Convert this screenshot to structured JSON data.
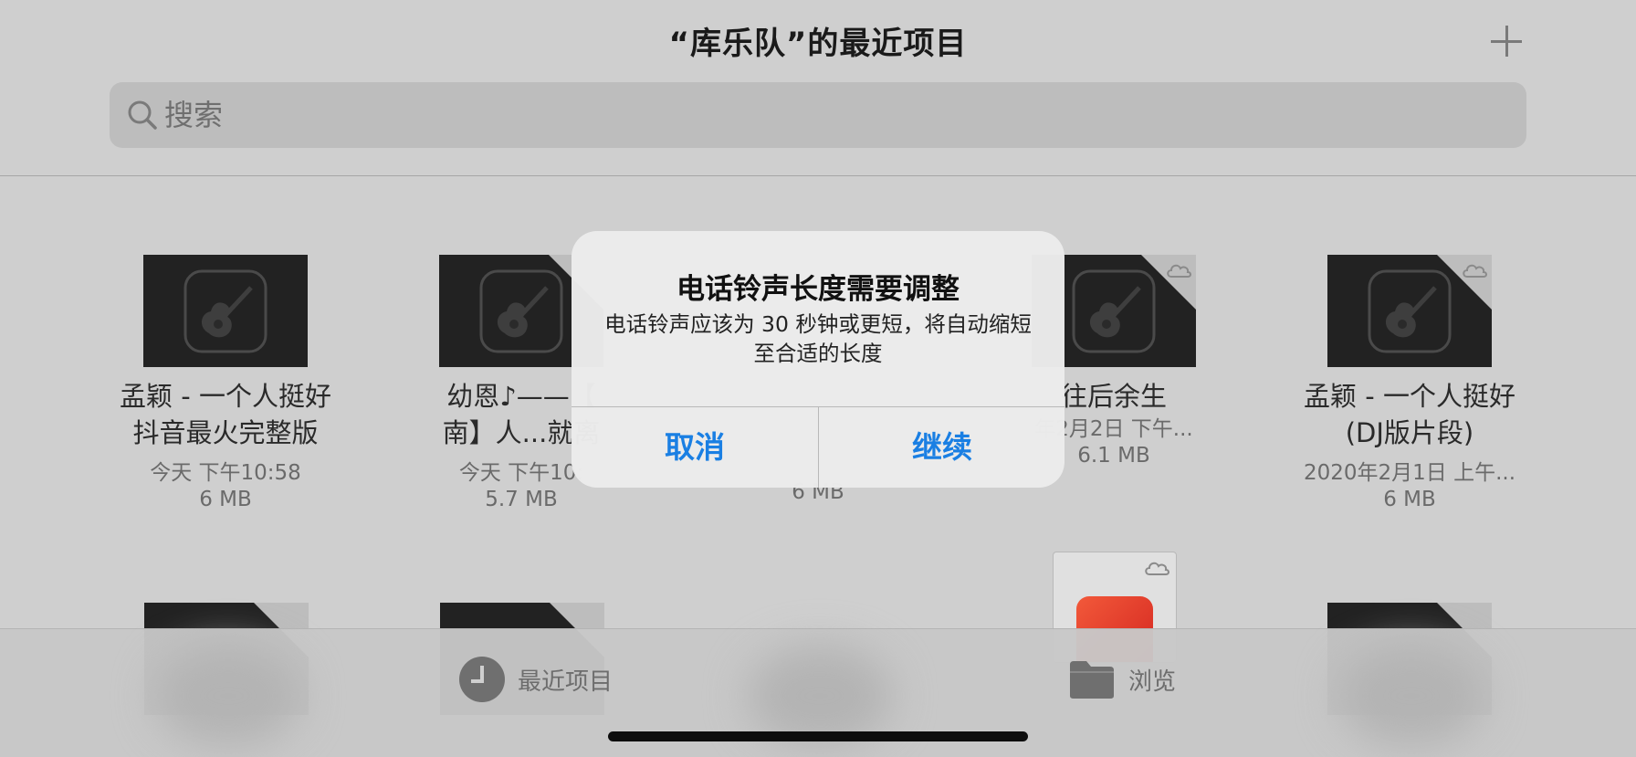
{
  "header": {
    "title": "“库乐队”的最近项目",
    "add_icon": "plus-icon",
    "search": {
      "placeholder": "搜索",
      "icon": "search-icon"
    }
  },
  "files": [
    {
      "name_line1": "孟颖 - 一个人挺好",
      "name_line2": "抖音最火完整版",
      "date": "今天 下午10:58",
      "size": "6 MB",
      "cloud": false
    },
    {
      "name_line1": "幼恩♪——【",
      "name_line2": "南】人...就离",
      "date": "今天 下午10:",
      "size": "5.7 MB",
      "cloud": true
    },
    {
      "name_line1": "",
      "name_line2": "",
      "date": "",
      "size": "6 MB",
      "cloud": false
    },
    {
      "name_line1": "往后余生",
      "name_line2": "",
      "date": "年2月2日 下午...",
      "size": "6.1 MB",
      "cloud": true
    },
    {
      "name_line1": "孟颖 - 一个人挺好",
      "name_line2": "(DJ版片段)",
      "date": "2020年2月1日 上午...",
      "size": "6 MB",
      "cloud": true
    }
  ],
  "tabs": [
    {
      "label": "最近项目",
      "icon": "clock-icon"
    },
    {
      "label": "浏览",
      "icon": "folder-icon"
    }
  ],
  "alert": {
    "title": "电话铃声长度需要调整",
    "message": "电话铃声应该为 30 秒钟或更短，将自动缩短至合适的长度",
    "cancel": "取消",
    "continue": "继续"
  },
  "colors": {
    "accent": "#1a7fe3",
    "background": "#cfcfcf",
    "thumbnail": "#222222"
  }
}
